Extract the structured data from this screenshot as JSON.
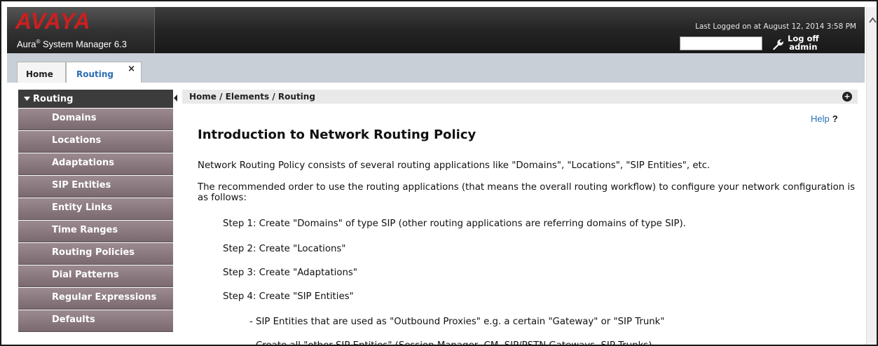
{
  "header": {
    "logo": "AVAYA",
    "product": "Aura",
    "product_reg": "®",
    "product_rest": " System Manager 6.3",
    "last_logged": "Last Logged on at August 12, 2014 3:58 PM",
    "logoff_line1": "Log off",
    "logoff_line2": "admin",
    "search_value": ""
  },
  "tabs": [
    {
      "label": "Home"
    },
    {
      "label": "Routing",
      "close": "×"
    }
  ],
  "sidebar": {
    "title": "Routing",
    "items": [
      {
        "label": "Domains"
      },
      {
        "label": "Locations"
      },
      {
        "label": "Adaptations"
      },
      {
        "label": "SIP Entities"
      },
      {
        "label": "Entity Links"
      },
      {
        "label": "Time Ranges"
      },
      {
        "label": "Routing Policies"
      },
      {
        "label": "Dial Patterns"
      },
      {
        "label": "Regular Expressions"
      },
      {
        "label": "Defaults"
      }
    ]
  },
  "content": {
    "breadcrumb": "Home / Elements / Routing",
    "help": "Help",
    "help_q": "?",
    "title": "Introduction to Network Routing Policy",
    "p1": "Network Routing Policy consists of several routing applications like \"Domains\", \"Locations\", \"SIP Entities\", etc.",
    "p2": "The recommended order to use the routing applications (that means the overall routing workflow) to configure your network configuration is as follows:",
    "steps": [
      "Step 1: Create \"Domains\" of type SIP (other routing applications are referring domains of type SIP).",
      "Step 2: Create \"Locations\"",
      "Step 3: Create \"Adaptations\"",
      "Step 4: Create \"SIP Entities\""
    ],
    "sub": [
      "- SIP Entities that are used as \"Outbound Proxies\" e.g. a certain \"Gateway\" or \"SIP Trunk\"",
      "- Create all \"other SIP Entities\" (Session Manager, CM, SIP/PSTN Gateways, SIP Trunks)"
    ]
  },
  "colors": {
    "logo_red": "#cc1f1f",
    "link_blue": "#2b6fb3",
    "sidebar_item": "#8a7a80",
    "sidebar_head": "#3c3c3c"
  },
  "icons": {
    "wrench": "wrench-icon",
    "plus": "plus-circle-icon",
    "sidebar_toggle": "triangle-down-icon",
    "collapse": "collapse-arrow-icon",
    "scroll_up": "scroll-up-arrow-icon"
  }
}
